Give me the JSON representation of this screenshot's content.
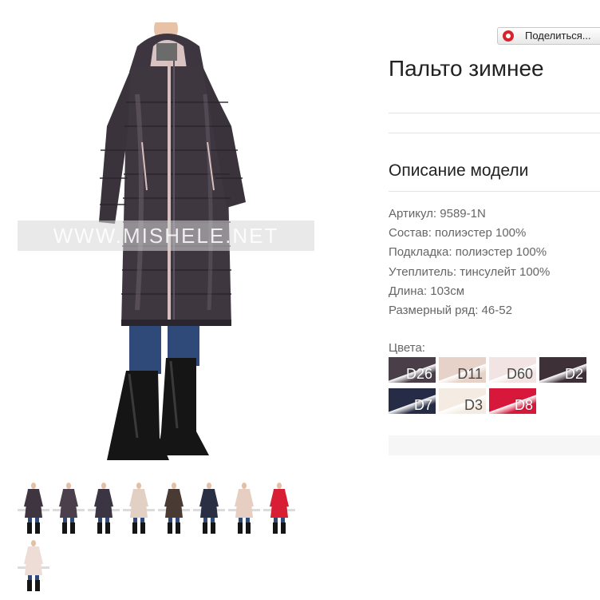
{
  "share": {
    "label": "Поделиться..."
  },
  "product": {
    "title": "Пальто зимнее",
    "description_heading": "Описание модели",
    "watermark": "WWW.MISHELE.NET",
    "specs": [
      "Артикул: 9589-1N",
      "Состав: полиэстер 100%",
      "Подкладка: полиэстер 100%",
      "Утеплитель: тинсулейт 100%",
      "Длина: 103см",
      "Размерный ряд: 46-52"
    ]
  },
  "colors": {
    "label": "Цвета:",
    "swatches": [
      {
        "code": "D26",
        "color": "#4a3f48"
      },
      {
        "code": "D11",
        "color": "#e6d2c8"
      },
      {
        "code": "D60",
        "color": "#f2e4e2"
      },
      {
        "code": "D2",
        "color": "#3e3037"
      },
      {
        "code": "D7",
        "color": "#262c45"
      },
      {
        "code": "D3",
        "color": "#f4ece2"
      },
      {
        "code": "D8",
        "color": "#d8183a"
      }
    ]
  },
  "thumbnails": [
    {
      "color": "#3e3540"
    },
    {
      "color": "#4a3f4a"
    },
    {
      "color": "#3b3442"
    },
    {
      "color": "#e2d0c4"
    },
    {
      "color": "#4a3a34"
    },
    {
      "color": "#2a2f44"
    },
    {
      "color": "#e6cfc2"
    },
    {
      "color": "#d81e34"
    },
    {
      "color": "#eedcd6"
    }
  ],
  "colors_theme": {
    "coat_main": "#3f3740",
    "coat_trim": "#d9c3c2",
    "jeans": "#2f4a78",
    "boots": "#151515"
  }
}
